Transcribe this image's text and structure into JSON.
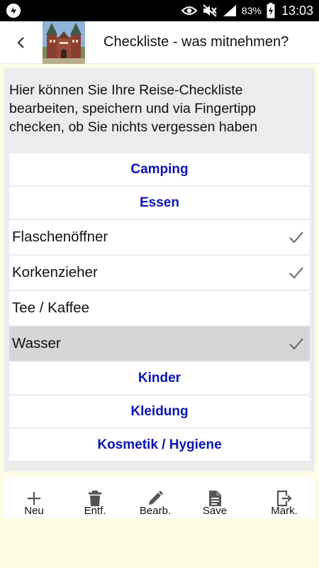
{
  "status_bar": {
    "battery_percent": "83%",
    "time": "13:03"
  },
  "app_bar": {
    "title": "Checkliste - was mitnehmen?"
  },
  "intro_text": "Hier können Sie Ihre Reise-Checkliste bearbeiten, speichern und via Fingertipp checken, ob Sie nichts vergessen haben",
  "list": {
    "rows": [
      {
        "type": "category",
        "label": "Camping"
      },
      {
        "type": "category",
        "label": "Essen"
      },
      {
        "type": "item",
        "label": "Flaschenöffner",
        "checked": true,
        "selected": false
      },
      {
        "type": "item",
        "label": "Korkenzieher",
        "checked": true,
        "selected": false
      },
      {
        "type": "item",
        "label": "Tee / Kaffee",
        "checked": false,
        "selected": false
      },
      {
        "type": "item",
        "label": "Wasser",
        "checked": true,
        "selected": true
      },
      {
        "type": "category",
        "label": "Kinder"
      },
      {
        "type": "category",
        "label": "Kleidung"
      },
      {
        "type": "category",
        "label": "Kosmetik / Hygiene"
      }
    ]
  },
  "toolbar": {
    "new_label": "Neu",
    "delete_label": "Entf.",
    "edit_label": "Bearb.",
    "save_label": "Save",
    "mark_label": "Mark."
  },
  "colors": {
    "category_text": "#0a14b4",
    "selected_row": "#d6d6d6",
    "background": "#fdfde6"
  }
}
